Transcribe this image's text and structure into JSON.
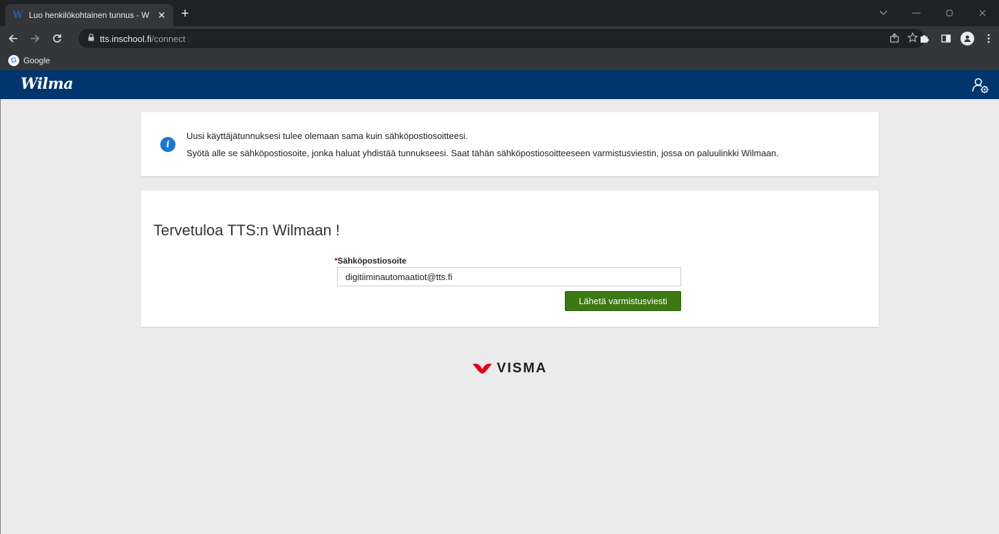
{
  "browser": {
    "tab_title": "Luo henkilökohtainen tunnus - W",
    "tab_favicon": "W",
    "new_tab": "+",
    "url_host": "tts.inschool.fi",
    "url_path": "/connect",
    "bookmark_label": "Google",
    "bookmark_icon": "G",
    "tab_close": "✕"
  },
  "header": {
    "logo": "Wilma",
    "accent": "#00366d"
  },
  "info": {
    "line1": "Uusi käyttäjätunnuksesi tulee olemaan sama kuin sähköpostiosoitteesi.",
    "line2": "Syötä alle se sähköpostiosoite, jonka haluat yhdistää tunnukseesi. Saat tähän sähköpostiosoitteeseen varmistusviestin, jossa on paluulinkki Wilmaan.",
    "icon_glyph": "i"
  },
  "form": {
    "welcome": "Tervetuloa TTS:n Wilmaan !",
    "required_mark": "*",
    "email_label": "Sähköpostiosoite",
    "email_value": "digitiiminautomaatiot@tts.fi",
    "submit_label": "Lähetä varmistusviesti",
    "button_color": "#3c7814"
  },
  "footer": {
    "brand": "VISMA"
  }
}
